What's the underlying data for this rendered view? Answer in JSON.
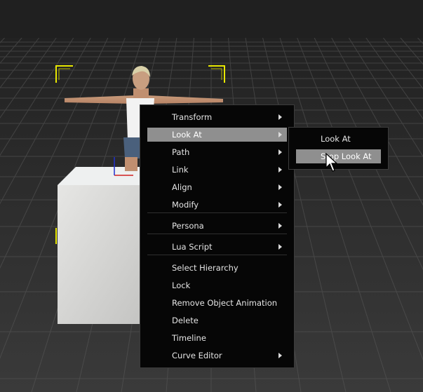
{
  "context_menu": {
    "items": [
      {
        "label": "Transform",
        "submenu": true
      },
      {
        "label": "Look At",
        "submenu": true,
        "highlighted": true
      },
      {
        "label": "Path",
        "submenu": true
      },
      {
        "label": "Link",
        "submenu": true
      },
      {
        "label": "Align",
        "submenu": true
      },
      {
        "label": "Modify",
        "submenu": true
      },
      {
        "label": "Persona",
        "submenu": true
      },
      {
        "label": "Lua Script",
        "submenu": true
      },
      {
        "label": "Select Hierarchy",
        "submenu": false
      },
      {
        "label": "Lock",
        "submenu": false
      },
      {
        "label": "Remove Object Animation",
        "submenu": false
      },
      {
        "label": "Delete",
        "submenu": false
      },
      {
        "label": "Timeline",
        "submenu": false
      },
      {
        "label": "Curve Editor",
        "submenu": true
      }
    ]
  },
  "submenu_look_at": {
    "items": [
      {
        "label": "Look At"
      },
      {
        "label": "Stop Look At",
        "highlighted": true
      }
    ]
  },
  "colors": {
    "menu_background": "#060606",
    "highlight": "#8f8f8f",
    "text": "#e4e4e4",
    "selection_bracket": "#e8e800"
  }
}
